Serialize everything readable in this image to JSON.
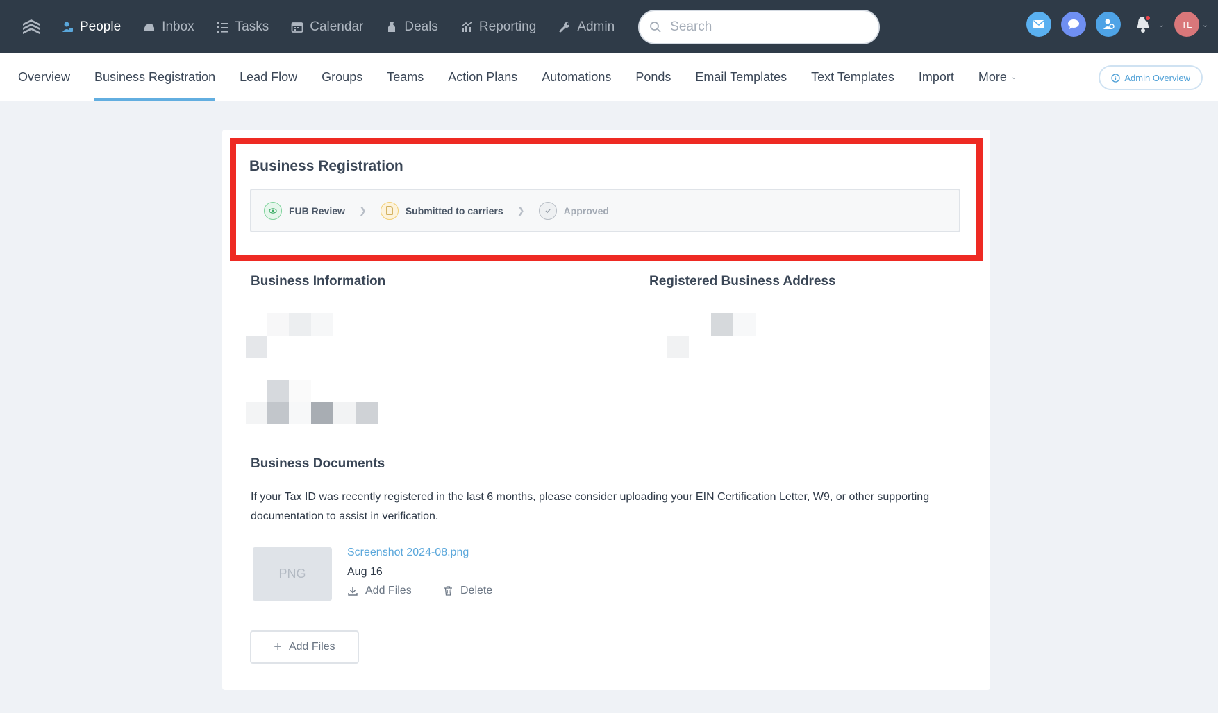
{
  "topnav": {
    "items": [
      {
        "label": "People",
        "icon": "people-icon"
      },
      {
        "label": "Inbox",
        "icon": "inbox-icon"
      },
      {
        "label": "Tasks",
        "icon": "tasks-icon"
      },
      {
        "label": "Calendar",
        "icon": "calendar-icon"
      },
      {
        "label": "Deals",
        "icon": "deals-icon"
      },
      {
        "label": "Reporting",
        "icon": "reporting-icon"
      },
      {
        "label": "Admin",
        "icon": "wrench-icon"
      }
    ],
    "search_placeholder": "Search",
    "avatar_initials": "TL",
    "colors": {
      "bar": "#2f3b48",
      "email": "#5ab0f0",
      "chat": "#6f8ff2",
      "dialer": "#4ea3e6",
      "avatar": "#d9777a"
    }
  },
  "subnav": {
    "items": [
      "Overview",
      "Business Registration",
      "Lead Flow",
      "Groups",
      "Teams",
      "Action Plans",
      "Automations",
      "Ponds",
      "Email Templates",
      "Text Templates",
      "Import",
      "More"
    ],
    "active": "Business Registration",
    "admin_overview": "Admin Overview"
  },
  "registration": {
    "title": "Business Registration",
    "steps": [
      {
        "label": "FUB Review",
        "state": "done"
      },
      {
        "label": "Submitted to carriers",
        "state": "current"
      },
      {
        "label": "Approved",
        "state": "pending"
      }
    ]
  },
  "business_information": {
    "title": "Business Information"
  },
  "registered_address": {
    "title": "Registered Business Address"
  },
  "documents": {
    "title": "Business Documents",
    "description": "If your Tax ID was recently registered in the last 6 months, please consider uploading your EIN Certification Letter, W9, or other supporting documentation to assist in verification.",
    "file": {
      "type": "PNG",
      "name": "Screenshot 2024-08.png",
      "date": "Aug 16",
      "add_files": "Add Files",
      "delete": "Delete"
    },
    "add_files_button": "Add Files"
  },
  "accent": "#62aee0",
  "highlight_color": "#ee2a23"
}
